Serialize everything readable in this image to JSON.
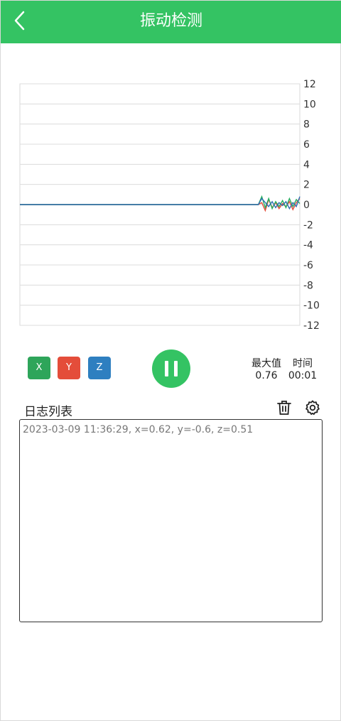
{
  "header": {
    "title": "振动检测",
    "back_icon": "chevron-left-icon"
  },
  "chart_data": {
    "type": "line",
    "yticks": [
      "12",
      "10",
      "8",
      "6",
      "4",
      "2",
      "0",
      "-2",
      "-4",
      "-6",
      "-8",
      "-10",
      "-12"
    ],
    "ylim": [
      -12,
      12
    ],
    "grid": true,
    "series": [
      {
        "color": "#e44d3a",
        "values": [
          0,
          0,
          0,
          0,
          0,
          0,
          0,
          0,
          0,
          0,
          0,
          0,
          0,
          0,
          0,
          0,
          0,
          0,
          0,
          0,
          0,
          0,
          0,
          0,
          0,
          0,
          0,
          0,
          0,
          0,
          0,
          0,
          0,
          0,
          0,
          0,
          0,
          0,
          0,
          0,
          0,
          0,
          0,
          0,
          0,
          0,
          0,
          0,
          0,
          0,
          0,
          0,
          0,
          0,
          0,
          0,
          0,
          0,
          0,
          0,
          0,
          0,
          0,
          0,
          0,
          0,
          0,
          0,
          0,
          0,
          0.2,
          -0.6,
          0.5,
          -0.3,
          0.2,
          -0.4,
          0.1,
          -0.2,
          0.3,
          -0.5,
          0.2,
          0.6
        ]
      },
      {
        "color": "#27ae60",
        "values": [
          0,
          0,
          0,
          0,
          0,
          0,
          0,
          0,
          0,
          0,
          0,
          0,
          0,
          0,
          0,
          0,
          0,
          0,
          0,
          0,
          0,
          0,
          0,
          0,
          0,
          0,
          0,
          0,
          0,
          0,
          0,
          0,
          0,
          0,
          0,
          0,
          0,
          0,
          0,
          0,
          0,
          0,
          0,
          0,
          0,
          0,
          0,
          0,
          0,
          0,
          0,
          0,
          0,
          0,
          0,
          0,
          0,
          0,
          0,
          0,
          0,
          0,
          0,
          0,
          0,
          0,
          0,
          0,
          0,
          0,
          0.8,
          -0.3,
          0.6,
          -0.4,
          0.3,
          -0.2,
          0.4,
          -0.3,
          0.6,
          -0.2,
          0.5,
          0.1
        ]
      },
      {
        "color": "#2e6fb3",
        "values": [
          0,
          0,
          0,
          0,
          0,
          0,
          0,
          0,
          0,
          0,
          0,
          0,
          0,
          0,
          0,
          0,
          0,
          0,
          0,
          0,
          0,
          0,
          0,
          0,
          0,
          0,
          0,
          0,
          0,
          0,
          0,
          0,
          0,
          0,
          0,
          0,
          0,
          0,
          0,
          0,
          0,
          0,
          0,
          0,
          0,
          0,
          0,
          0,
          0,
          0,
          0,
          0,
          0,
          0,
          0,
          0,
          0,
          0,
          0,
          0,
          0,
          0,
          0,
          0,
          0,
          0,
          0,
          0,
          0,
          0,
          0.6,
          0.2,
          -0.2,
          0.3,
          -0.3,
          0.2,
          -0.1,
          0.3,
          -0.4,
          0.2,
          -0.2,
          0.8
        ]
      }
    ]
  },
  "controls": {
    "x_label": "X",
    "y_label": "Y",
    "z_label": "Z",
    "x_color": "#2ea55a",
    "y_color": "#e44d3a",
    "z_color": "#2e7fc0",
    "pause_icon": "pause-icon"
  },
  "stats": {
    "max_label": "最大值",
    "max_value": "0.76",
    "time_label": "时间",
    "time_value": "00:01"
  },
  "log": {
    "title": "日志列表",
    "delete_icon": "trash-icon",
    "settings_icon": "gear-icon",
    "entries": [
      "2023-03-09 11:36:29, x=0.62, y=-0.6, z=0.51"
    ]
  }
}
